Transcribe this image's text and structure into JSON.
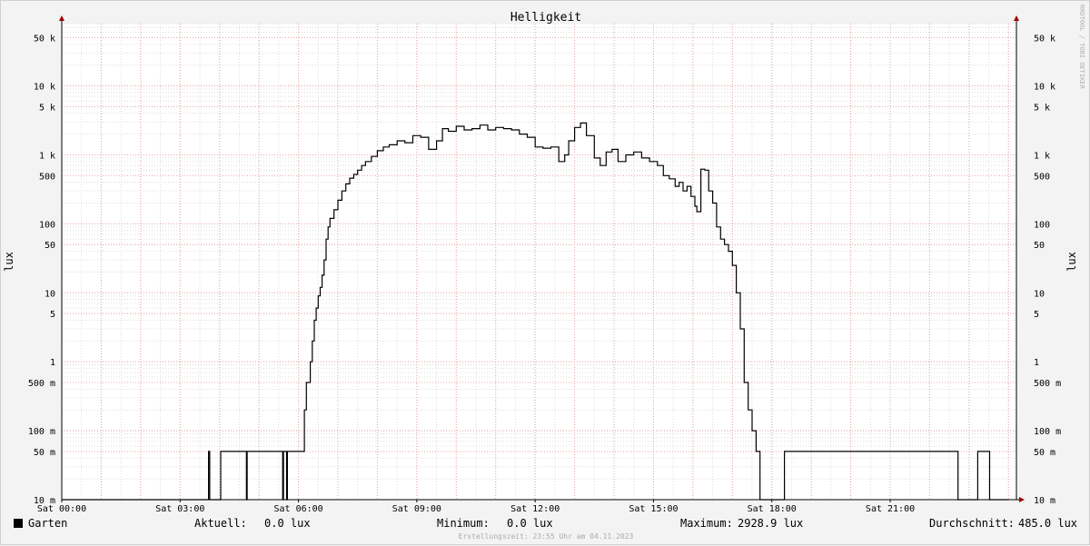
{
  "chart_data": {
    "type": "line",
    "title": "Helligkeit",
    "ylabel_left": "lux",
    "ylabel_right": "lux",
    "y_scale": "log",
    "ylim": [
      0.01,
      80000
    ],
    "xlim": [
      0,
      24.2
    ],
    "grid": true,
    "y_ticks": [
      {
        "value": 0.01,
        "label": "10 m"
      },
      {
        "value": 0.05,
        "label": "50 m"
      },
      {
        "value": 0.1,
        "label": "100 m"
      },
      {
        "value": 0.5,
        "label": "500 m"
      },
      {
        "value": 1,
        "label": "1"
      },
      {
        "value": 5,
        "label": "5"
      },
      {
        "value": 10,
        "label": "10"
      },
      {
        "value": 50,
        "label": "50"
      },
      {
        "value": 100,
        "label": "100"
      },
      {
        "value": 500,
        "label": "500"
      },
      {
        "value": 1000,
        "label": "1 k"
      },
      {
        "value": 5000,
        "label": "5 k"
      },
      {
        "value": 10000,
        "label": "10 k"
      },
      {
        "value": 50000,
        "label": "50 k"
      }
    ],
    "x_ticks": [
      {
        "value": 0,
        "label": "Sat 00:00"
      },
      {
        "value": 3,
        "label": "Sat 03:00"
      },
      {
        "value": 6,
        "label": "Sat 06:00"
      },
      {
        "value": 9,
        "label": "Sat 09:00"
      },
      {
        "value": 12,
        "label": "Sat 12:00"
      },
      {
        "value": 15,
        "label": "Sat 15:00"
      },
      {
        "value": 18,
        "label": "Sat 18:00"
      },
      {
        "value": 21,
        "label": "Sat 21:00"
      }
    ],
    "series": [
      {
        "name": "Garten",
        "color": "#000000",
        "x": [
          0,
          3.72,
          3.75,
          3.78,
          4.03,
          4.05,
          4.68,
          4.7,
          4.79,
          4.81,
          5.6,
          5.62,
          5.7,
          5.72,
          6.02,
          6.04,
          6.15,
          6.2,
          6.3,
          6.35,
          6.4,
          6.45,
          6.5,
          6.55,
          6.6,
          6.65,
          6.7,
          6.75,
          6.8,
          6.9,
          7.0,
          7.1,
          7.2,
          7.3,
          7.4,
          7.5,
          7.6,
          7.7,
          7.85,
          8.0,
          8.15,
          8.3,
          8.5,
          8.7,
          8.9,
          9.1,
          9.3,
          9.5,
          9.65,
          9.8,
          10.0,
          10.2,
          10.4,
          10.6,
          10.8,
          11.0,
          11.2,
          11.4,
          11.6,
          11.8,
          12.0,
          12.2,
          12.4,
          12.6,
          12.75,
          12.85,
          13.0,
          13.15,
          13.3,
          13.5,
          13.65,
          13.8,
          13.95,
          14.1,
          14.3,
          14.5,
          14.7,
          14.9,
          15.1,
          15.25,
          15.4,
          15.55,
          15.65,
          15.75,
          15.85,
          15.95,
          16.05,
          16.1,
          16.2,
          16.3,
          16.4,
          16.5,
          16.6,
          16.7,
          16.8,
          16.9,
          17.0,
          17.1,
          17.2,
          17.3,
          17.4,
          17.5,
          17.6,
          17.7,
          17.8,
          17.9,
          18.3,
          18.32,
          22.7,
          22.72,
          23.2,
          23.22,
          23.5,
          23.52,
          24.0
        ],
        "y": [
          0.01,
          0.05,
          0.01,
          0.01,
          0.05,
          0.05,
          0.01,
          0.05,
          0.05,
          0.05,
          0.01,
          0.05,
          0.01,
          0.05,
          0.05,
          0.05,
          0.2,
          0.5,
          1,
          2,
          4,
          6,
          9,
          12,
          18,
          30,
          60,
          90,
          120,
          160,
          220,
          300,
          380,
          460,
          520,
          600,
          700,
          800,
          950,
          1150,
          1300,
          1400,
          1600,
          1500,
          1900,
          1800,
          1200,
          1600,
          2400,
          2200,
          2600,
          2300,
          2400,
          2700,
          2300,
          2500,
          2400,
          2300,
          2000,
          1800,
          1300,
          1250,
          1300,
          800,
          1000,
          1600,
          2500,
          2900,
          1900,
          900,
          700,
          1100,
          1200,
          800,
          1000,
          1100,
          900,
          800,
          700,
          500,
          450,
          350,
          400,
          300,
          350,
          250,
          180,
          150,
          620,
          600,
          300,
          200,
          90,
          60,
          50,
          40,
          25,
          10,
          3,
          0.5,
          0.2,
          0.1,
          0.05,
          0.01,
          0.01,
          0.01,
          0.01,
          0.05,
          0.05,
          0.01,
          0.01,
          0.05,
          0.05,
          0.01,
          0.01
        ]
      }
    ]
  },
  "legend": {
    "series_name": "Garten",
    "current_label": "Aktuell:",
    "current_value": "0.0 lux",
    "min_label": "Minimum:",
    "min_value": "0.0 lux",
    "max_label": "Maximum:",
    "max_value": "2928.9 lux",
    "avg_label": "Durchschnitt:",
    "avg_value": "485.0 lux"
  },
  "footer": "Erstellungszeit: 23:55 Uhr am 04.11.2023",
  "watermark": "RRDTOOL / TOBI OETIKER"
}
